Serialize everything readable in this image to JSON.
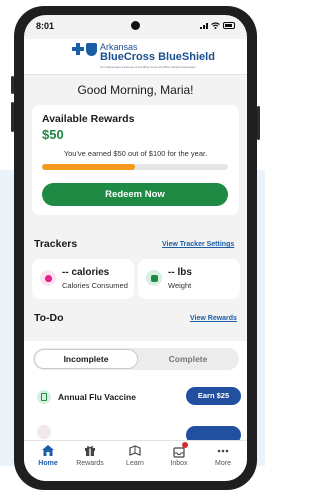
{
  "status_bar": {
    "time": "8:01"
  },
  "header": {
    "brand_top": "Arkansas",
    "brand_main": "BlueCross BlueShield",
    "brand_sub": "An Independent Licensee of the Blue Cross and Blue Shield Association"
  },
  "greeting": "Good Morning, Maria!",
  "rewards": {
    "title": "Available Rewards",
    "amount": "$50",
    "earned_text": "You've earned $50 out of $100 for the year.",
    "progress_fraction": 0.5,
    "redeem_label": "Redeem Now"
  },
  "trackers": {
    "title": "Trackers",
    "link": "View Tracker Settings",
    "items": [
      {
        "value": "-- calories",
        "label": "Calories Consumed",
        "icon": "apple-icon",
        "color": "#e8208c",
        "bg": "#fde3ef"
      },
      {
        "value": "-- lbs",
        "label": "Weight",
        "icon": "scale-icon",
        "color": "#1e8a44",
        "bg": "#d6efe1"
      }
    ]
  },
  "todo": {
    "title": "To-Do",
    "link": "View Rewards",
    "tabs": {
      "active": "Incomplete",
      "inactive": "Complete"
    },
    "items": [
      {
        "label": "Annual Flu Vaccine",
        "button": "Earn $25",
        "icon": "clipboard-icon"
      }
    ]
  },
  "nav": [
    {
      "label": "Home",
      "icon": "home-icon",
      "active": true
    },
    {
      "label": "Rewards",
      "icon": "gift-icon",
      "active": false
    },
    {
      "label": "Learn",
      "icon": "learn-icon",
      "active": false
    },
    {
      "label": "Inbox",
      "icon": "inbox-icon",
      "active": false,
      "badge": true
    },
    {
      "label": "More",
      "icon": "more-icon",
      "active": false
    }
  ],
  "colors": {
    "brand_blue": "#1a5ea8",
    "green": "#1e8a44",
    "progress_orange": "#f39a1f",
    "earn_button": "#2250a0"
  }
}
